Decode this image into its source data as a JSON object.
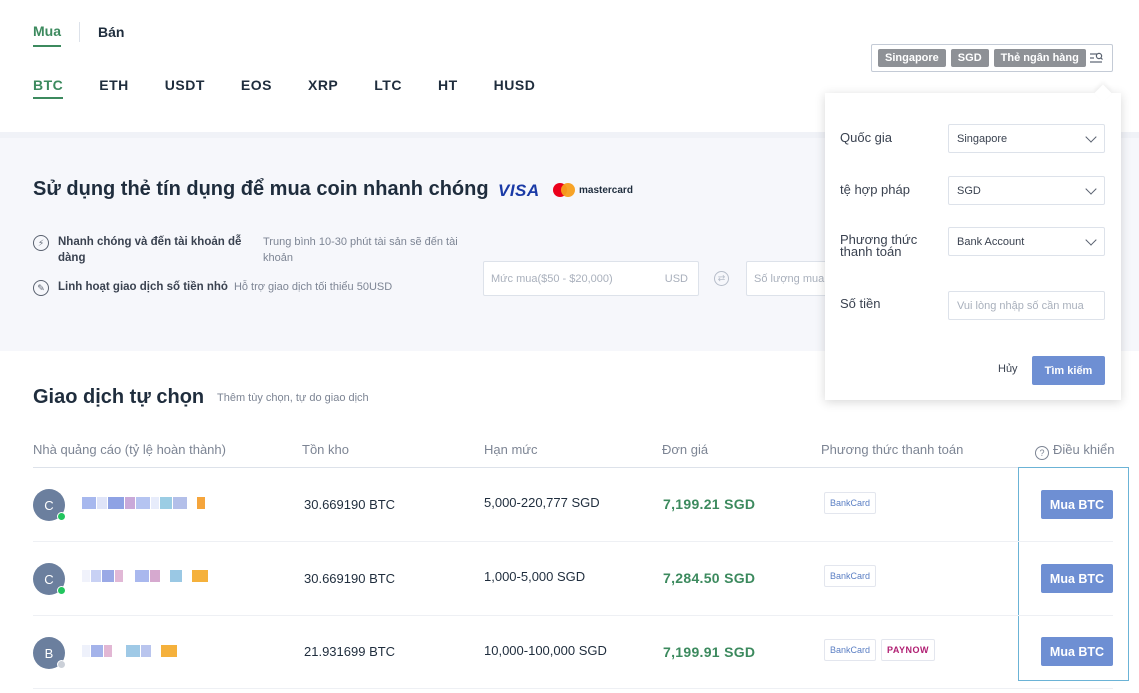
{
  "side_tabs": [
    {
      "label": "Mua",
      "active": true
    },
    {
      "label": "Bán",
      "active": false
    }
  ],
  "coin_tabs": [
    {
      "label": "BTC",
      "active": true
    },
    {
      "label": "ETH",
      "active": false
    },
    {
      "label": "USDT",
      "active": false
    },
    {
      "label": "EOS",
      "active": false
    },
    {
      "label": "XRP",
      "active": false
    },
    {
      "label": "LTC",
      "active": false
    },
    {
      "label": "HT",
      "active": false
    },
    {
      "label": "HUSD",
      "active": false
    }
  ],
  "filter": {
    "chips": [
      "Singapore",
      "SGD",
      "Thẻ ngân hàng"
    ],
    "icon": "filter-search-icon"
  },
  "banner": {
    "title": "Sử dụng thẻ tín dụng để mua coin nhanh chóng",
    "visa": "VISA",
    "mastercard": "mastercard",
    "features": [
      {
        "icon": "lightning-icon",
        "title": "Nhanh chóng và đến tài khoản dễ dàng",
        "desc": "Trung bình 10-30 phút tài sản sẽ đến tài khoản"
      },
      {
        "icon": "coins-icon",
        "title": "Linh hoạt giao dịch số tiền nhỏ",
        "desc": "Hỗ trợ giao dịch tối thiểu 50USD"
      }
    ],
    "amount_placeholder": "Mức mua($50 - $20,000)",
    "amount_currency": "USD",
    "qty_placeholder": "Số lượng mua"
  },
  "panel": {
    "country_label": "Quốc gia",
    "country_value": "Singapore",
    "fiat_label": "tệ hợp pháp",
    "fiat_value": "SGD",
    "payment_label": "Phương thức thanh toán",
    "payment_value": "Bank Account",
    "amount_label": "Số tiền",
    "amount_placeholder": "Vui lòng nhập số cần mua",
    "cancel": "Hủy",
    "search": "Tìm kiếm"
  },
  "section": {
    "title": "Giao dịch tự chọn",
    "subtitle": "Thêm tùy chọn, tự do giao dịch"
  },
  "table": {
    "headers": {
      "advertiser": "Nhà quảng cáo (tỷ lệ hoàn thành)",
      "stock": "Tồn kho",
      "limit": "Hạn mức",
      "price": "Đơn giá",
      "payment": "Phương thức thanh toán",
      "action": "Điều khiển"
    },
    "rows": [
      {
        "initial": "C",
        "status_color": "#22c55e",
        "stock": "30.669190 BTC",
        "limit": "5,000-220,777 SGD",
        "price": "7,199.21 SGD",
        "payments": [
          "BankCard"
        ],
        "action": "Mua BTC"
      },
      {
        "initial": "C",
        "status_color": "#22c55e",
        "stock": "30.669190 BTC",
        "limit": "1,000-5,000 SGD",
        "price": "7,284.50 SGD",
        "payments": [
          "BankCard"
        ],
        "action": "Mua BTC"
      },
      {
        "initial": "B",
        "status_color": "#cbd0d8",
        "stock": "21.931699 BTC",
        "limit": "10,000-100,000 SGD",
        "price": "7,199.91 SGD",
        "payments": [
          "BankCard",
          "PAYNOW"
        ],
        "action": "Mua BTC"
      }
    ]
  },
  "colors": {
    "accent_green": "#3c8a5e",
    "button_blue": "#6e8fd3",
    "chip_gray": "#8e9196"
  }
}
